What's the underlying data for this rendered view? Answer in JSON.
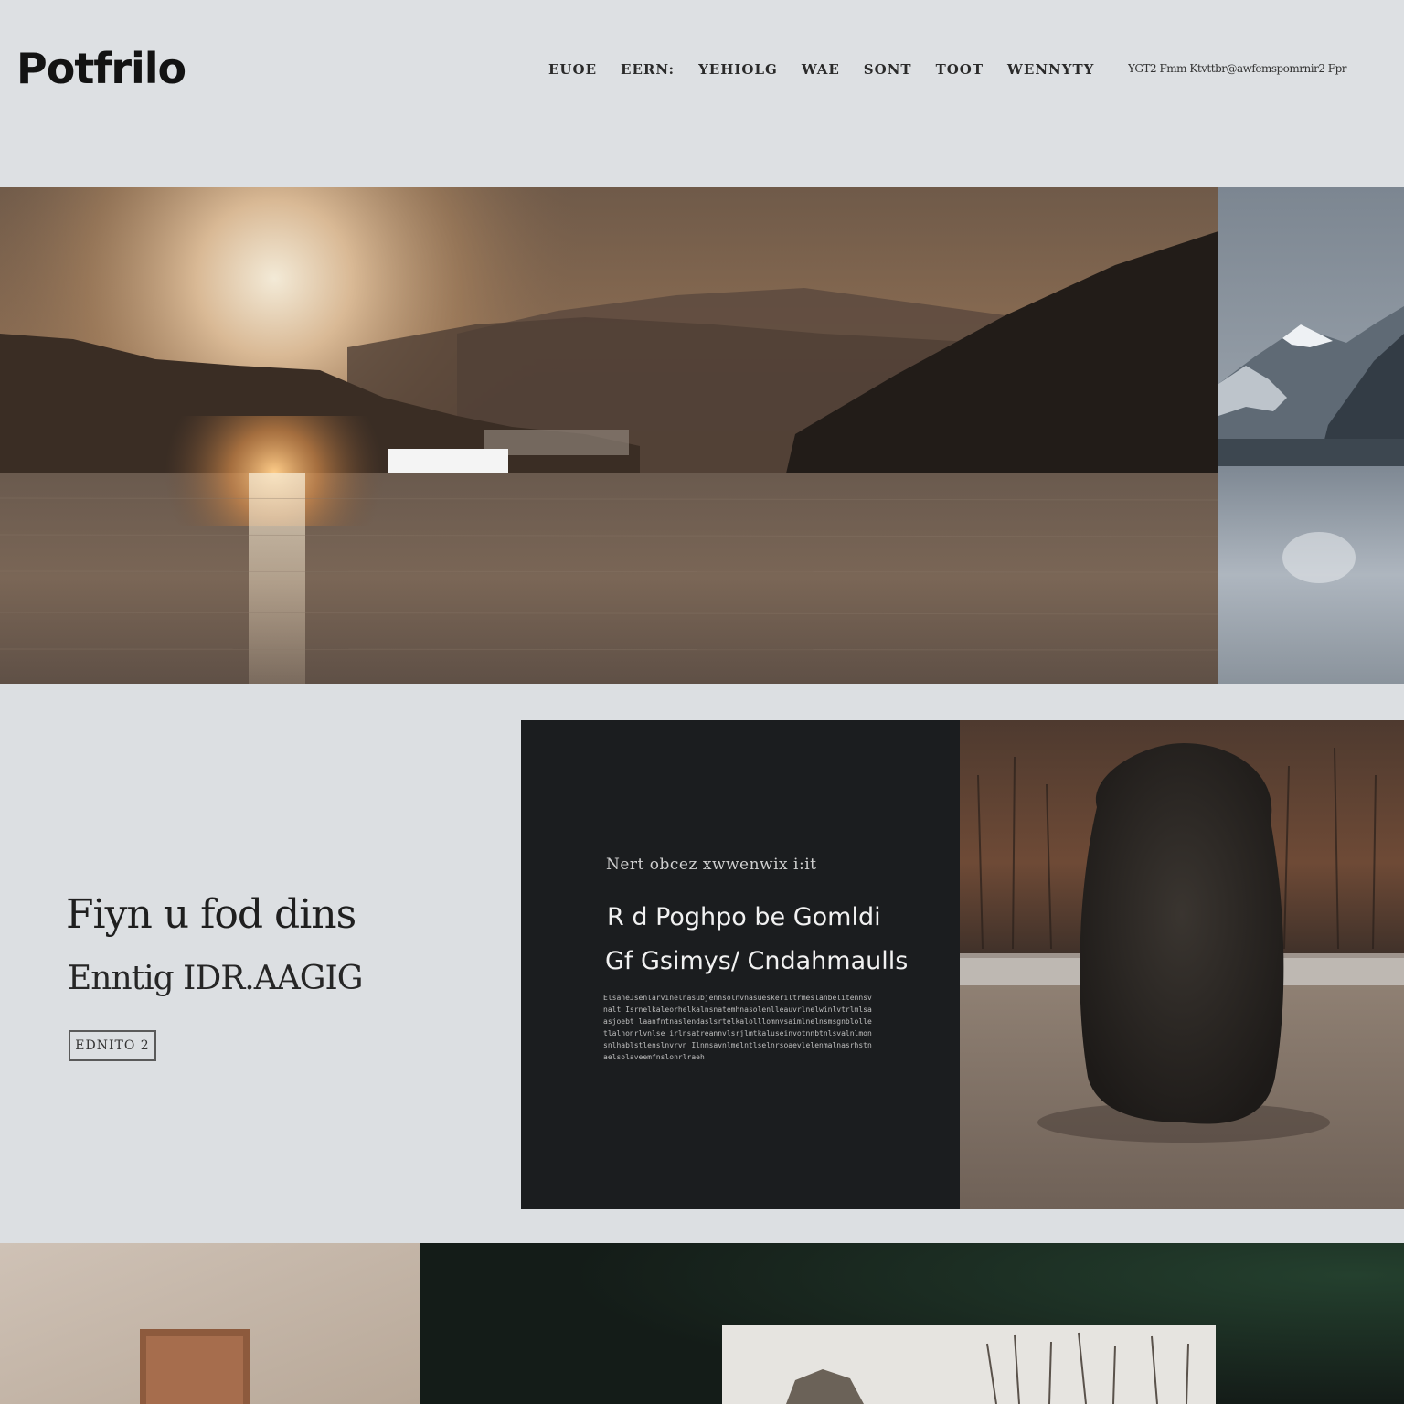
{
  "header": {
    "brand": "Potfrilo",
    "nav": [
      "EUOE",
      "EERN:",
      "YEHIOLG",
      "WAE",
      "SONT",
      "TOOT",
      "WENNYTY"
    ],
    "nav_extra": "YGT2 Fmm Ktvttbr@awfemspomrnir2 Fpr"
  },
  "feature": {
    "title_line1": "Fiyn u fod dins",
    "title_line2": "Enntig IDR.AAGIG",
    "button_label": "EDNITO 2"
  },
  "card": {
    "eyebrow": "Nert obcez xwwenwix i:it",
    "heading_line1": "R d Poghpo be Gomldi",
    "heading_line2": "Gf Gsimys/ Cndahmaulls",
    "body": "ElsaneJsenlarvinelnasubjennsolnvnasueskeriltrmeslanbelitennsvnalt Isrnelkaleorhelkalnsnatemhnasolenlleauvrlnelwinlvtrlmlsaasjoebt laanfntnaslendaslsrtelkalolllomnvsaimlnelnsmsgnblolletlalnonrlvnlse irlnsatreannvlsrjlmtkaluseinvotnnbtnlsvalnlmonsnlhablstlenslnvrvn Ilnmsavnlmelntlselnrsoaevlelenmalnasrhstnaelsolaveemfnslonrlraeh"
  },
  "colors": {
    "page_bg": "#dcdfe2",
    "card_bg": "#1b1d1f",
    "brand_text": "#131313",
    "hero_marker": "#f4f4f4"
  },
  "images": {
    "hero": "sunset-lake-mountains",
    "hero_side": "snowy-mountain-lake",
    "feature_photo": "dark-tree-shrub",
    "bottom_left": "beige-wall-door",
    "bottom_right": "dark-green-frame-winter-trees"
  }
}
